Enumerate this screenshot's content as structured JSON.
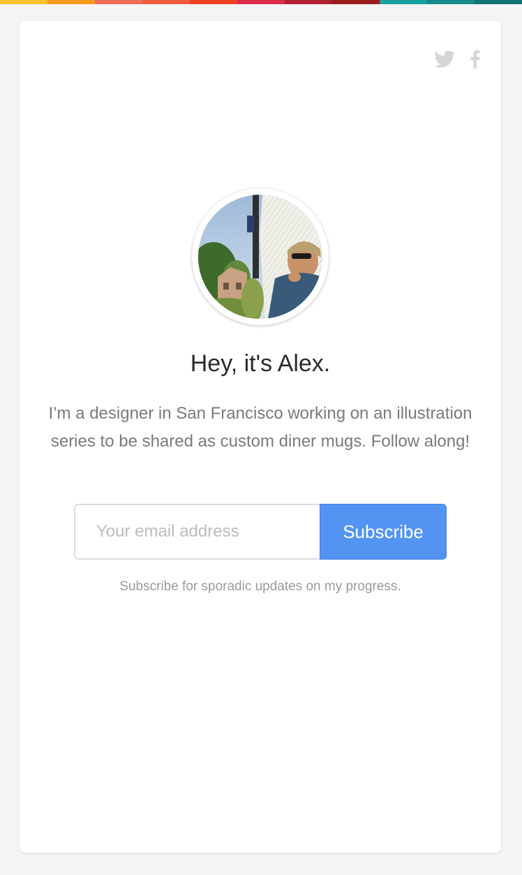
{
  "top_strip": {
    "colors": [
      "#f7c12f",
      "#f59a1a",
      "#ef6b5a",
      "#f25a3d",
      "#f1401f",
      "#d92c4a",
      "#b01f31",
      "#9a1c1c",
      "#16a0a0",
      "#148a8a",
      "#0f7474"
    ]
  },
  "social": {
    "twitter_icon": "twitter-icon",
    "facebook_icon": "facebook-icon"
  },
  "profile": {
    "headline": "Hey, it's Alex.",
    "bio": "I’m a designer in San Francisco working on an illustration series to be shared as custom diner mugs. Follow along!"
  },
  "subscribe_form": {
    "email_placeholder": "Your email address",
    "email_value": "",
    "button_label": "Subscribe",
    "note": "Subscribe for sporadic updates on my progress."
  },
  "colors": {
    "button": "#5394f2",
    "background": "#f4f4f4",
    "card": "#ffffff"
  }
}
